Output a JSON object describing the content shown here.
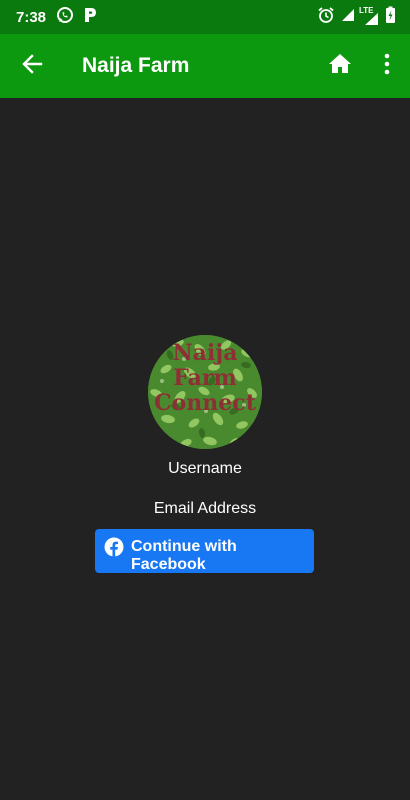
{
  "status_bar": {
    "time": "7:38",
    "network_label": "LTE",
    "icons": [
      "whatsapp-icon",
      "p-icon",
      "alarm-icon",
      "signal-icon",
      "lte-signal-icon",
      "battery-charging-icon"
    ]
  },
  "app_bar": {
    "title": "Naija Farm",
    "back_icon": "arrow-back-icon",
    "home_icon": "home-icon",
    "more_icon": "more-vert-icon"
  },
  "profile": {
    "logo_lines": [
      "Naija",
      "Farm",
      "Connect"
    ],
    "username_label": "Username",
    "email_label": "Email Address"
  },
  "facebook_button": {
    "label": "Continue with Facebook",
    "icon": "facebook-icon"
  },
  "colors": {
    "status_bar": "#0a7a0e",
    "app_bar": "#0c980f",
    "background": "#222222",
    "facebook_blue": "#1877f2",
    "logo_text": "#8e2f36"
  }
}
